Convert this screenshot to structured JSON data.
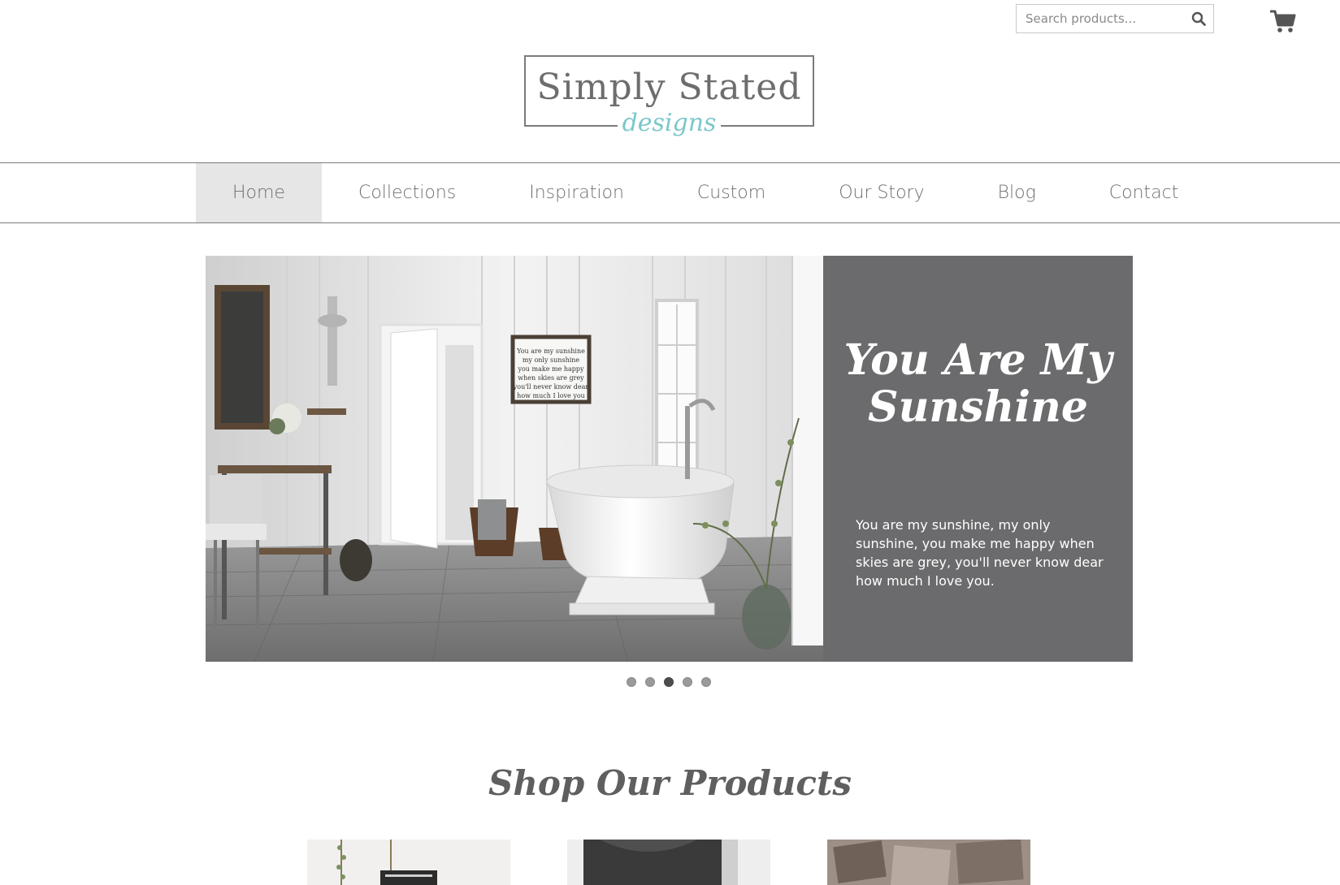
{
  "header": {
    "search": {
      "placeholder": "Search products..."
    },
    "icons": {
      "search": "search-icon",
      "cart": "shopping-cart-icon"
    }
  },
  "logo": {
    "main": "Simply Stated",
    "sub": "designs"
  },
  "nav": {
    "items": [
      {
        "label": "Home",
        "active": true
      },
      {
        "label": "Collections"
      },
      {
        "label": "Inspiration"
      },
      {
        "label": "Custom"
      },
      {
        "label": "Our Story"
      },
      {
        "label": "Blog"
      },
      {
        "label": "Contact"
      }
    ]
  },
  "hero": {
    "title_line1": "You Are My",
    "title_line2": "Sunshine",
    "sign_lines": [
      "You are my sunshine",
      "my only sunshine",
      "you make me happy",
      "when skies are grey",
      "you'll never know dear",
      "how much I love you"
    ],
    "body": "You are my sunshine, my only sunshine, you make me happy when skies are grey, you'll never know dear how much I love you.",
    "slide_count": 5,
    "active_slide": 3,
    "panel_color": "#6b6b6d"
  },
  "products": {
    "title": "Shop Our Products",
    "items": [
      {
        "thumb": "wall-sign-product"
      },
      {
        "thumb": "wrapped-canvas-product"
      },
      {
        "thumb": "photo-collage-product"
      }
    ]
  },
  "colors": {
    "accent": "#7cc7cb",
    "text": "#707070",
    "nav_active_bg": "#e6e6e6"
  }
}
